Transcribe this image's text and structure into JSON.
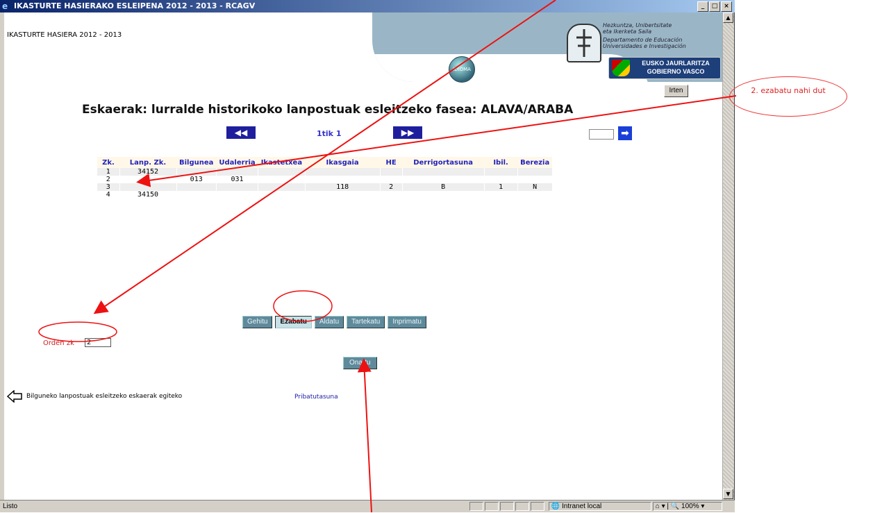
{
  "window": {
    "title": "IKASTURTE HASIERAKO ESLEIPENA 2012 - 2013 - RCAGV",
    "controls": [
      "_",
      "□",
      "×"
    ]
  },
  "header": {
    "school_year": "IKASTURTE HASIERA 2012 - 2013",
    "idioma_label": "IDIOMA",
    "dept_lines": [
      "Hezkuntza, Unibertsitate",
      "eta Ikerketa Saila",
      "Departamento de Educación",
      "Universidades e Investigación"
    ],
    "badge_line1": "EUSKO JAURLARITZA",
    "badge_line2": "GOBIERNO VASCO",
    "exit_label": "Irten"
  },
  "page_title": "Eskaerak: lurralde historikoko lanpostuak esleitzeko fasea: ALAVA/ARABA",
  "pager": {
    "prev_icon": "double-left-arrow-icon",
    "next_icon": "double-right-arrow-icon",
    "page_text": "1tik 1",
    "goto_value": ""
  },
  "table": {
    "columns": [
      "Zk.",
      "Lanp. Zk.",
      "Bilgunea",
      "Udalerria",
      "Ikastetxea",
      "Ikasgaia",
      "HE",
      "Derrigortasuna",
      "Ibil.",
      "Berezia"
    ],
    "rows": [
      [
        "1",
        "34152",
        "",
        "",
        "",
        "",
        "",
        "",
        "",
        ""
      ],
      [
        "2",
        "",
        "013",
        "031",
        "",
        "",
        "",
        "",
        "",
        ""
      ],
      [
        "3",
        "",
        "",
        "",
        "",
        "118",
        "2",
        "B",
        "1",
        "N"
      ],
      [
        "4",
        "34150",
        "",
        "",
        "",
        "",
        "",
        "",
        "",
        ""
      ]
    ]
  },
  "toolbar": {
    "add": "Gehitu",
    "delete": "Ezabatu",
    "modify": "Aldatu",
    "insert": "Tartekatu",
    "print": "Inprimatu"
  },
  "orden": {
    "label": "Orden zk",
    "value": "2"
  },
  "accept_label": "Onartu",
  "footer": {
    "back_text": "Bilguneko lanpostuak esleitzeko eskaerak egiteko",
    "privacy": "Pribatutasuna"
  },
  "status": {
    "text": "Listo",
    "zone": "Intranet local",
    "zoom": "100%"
  },
  "annotation": {
    "callout": "2. ezabatu nahi dut",
    "color": "#ee1111"
  }
}
